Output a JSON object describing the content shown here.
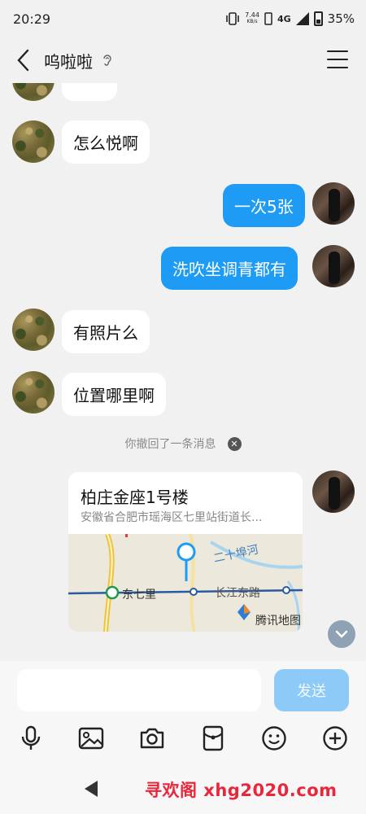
{
  "status_bar": {
    "time": "20:29",
    "net_speed": "7.44",
    "net_unit": "KB/s",
    "network": "4G",
    "battery": "35%"
  },
  "header": {
    "title": "呜啦啦"
  },
  "messages": [
    {
      "side": "in",
      "text": "怎么悦啊"
    },
    {
      "side": "out",
      "text": "一次5张"
    },
    {
      "side": "out",
      "text": "洗吹坐调青都有"
    },
    {
      "side": "in",
      "text": "有照片么"
    },
    {
      "side": "in",
      "text": "位置哪里啊"
    }
  ],
  "recall_note": "你撤回了一条消息",
  "location": {
    "title": "柏庄金座1号楼",
    "address": "安徽省合肥市瑶海区七里站街道长...",
    "map_labels": {
      "station": "东七里",
      "road": "长江东路",
      "river": "二十埠河",
      "provider": "腾讯地图"
    }
  },
  "input": {
    "placeholder": "",
    "send_label": "发送"
  },
  "watermark": "寻欢阁 xhg2020.com",
  "colors": {
    "accent": "#1e9cf5",
    "send_disabled": "#8ecaf7",
    "background": "#f1f1f2"
  },
  "icons": [
    "back-icon",
    "ear-icon",
    "menu-icon",
    "microphone-icon",
    "image-icon",
    "camera-icon",
    "red-packet-icon",
    "emoji-icon",
    "plus-icon",
    "chevron-down-icon"
  ]
}
